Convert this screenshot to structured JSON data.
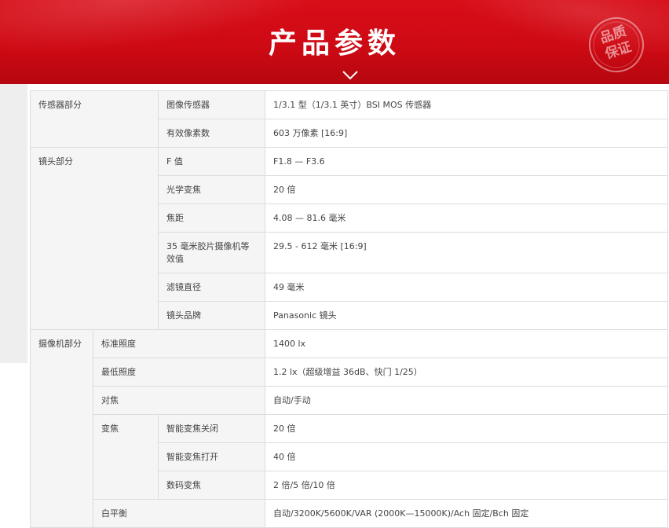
{
  "header": {
    "title": "产品参数",
    "seal_text": [
      "品质",
      "保证"
    ]
  },
  "sections": {
    "sensor": {
      "label": "传感器部分",
      "rows": [
        {
          "label": "图像传感器",
          "value": "1/3.1 型（1/3.1 英寸）BSI MOS 传感器"
        },
        {
          "label": "有效像素数",
          "value": "603 万像素 [16:9]"
        }
      ]
    },
    "lens": {
      "label": "镜头部分",
      "rows": [
        {
          "label": "F 值",
          "value": "F1.8 — F3.6"
        },
        {
          "label": "光学变焦",
          "value": "20 倍"
        },
        {
          "label": "焦距",
          "value": "4.08 — 81.6 毫米"
        },
        {
          "label": "35 毫米胶片摄像机等效值",
          "value": "29.5 - 612 毫米 [16:9]"
        },
        {
          "label": "滤镜直径",
          "value": "49 毫米"
        },
        {
          "label": "镜头品牌",
          "value": "Panasonic 镜头"
        }
      ]
    },
    "camera": {
      "label": "摄像机部分",
      "standard_illumination": {
        "label": "标准照度",
        "value": "1400 lx"
      },
      "min_illumination": {
        "label": "最低照度",
        "value": "1.2 lx（超级增益 36dB、快门 1/25）"
      },
      "focus": {
        "label": "对焦",
        "value": "自动/手动"
      },
      "zoom": {
        "label": "变焦",
        "rows": [
          {
            "label": "智能变焦关闭",
            "value": "20 倍"
          },
          {
            "label": "智能变焦打开",
            "value": "40 倍"
          },
          {
            "label": "数码变焦",
            "value": "2 倍/5 倍/10 倍"
          }
        ]
      },
      "white_balance": {
        "label": "白平衡",
        "value": "自动/3200K/5600K/VAR (2000K—15000K)/Ach 固定/Bch 固定"
      }
    }
  }
}
